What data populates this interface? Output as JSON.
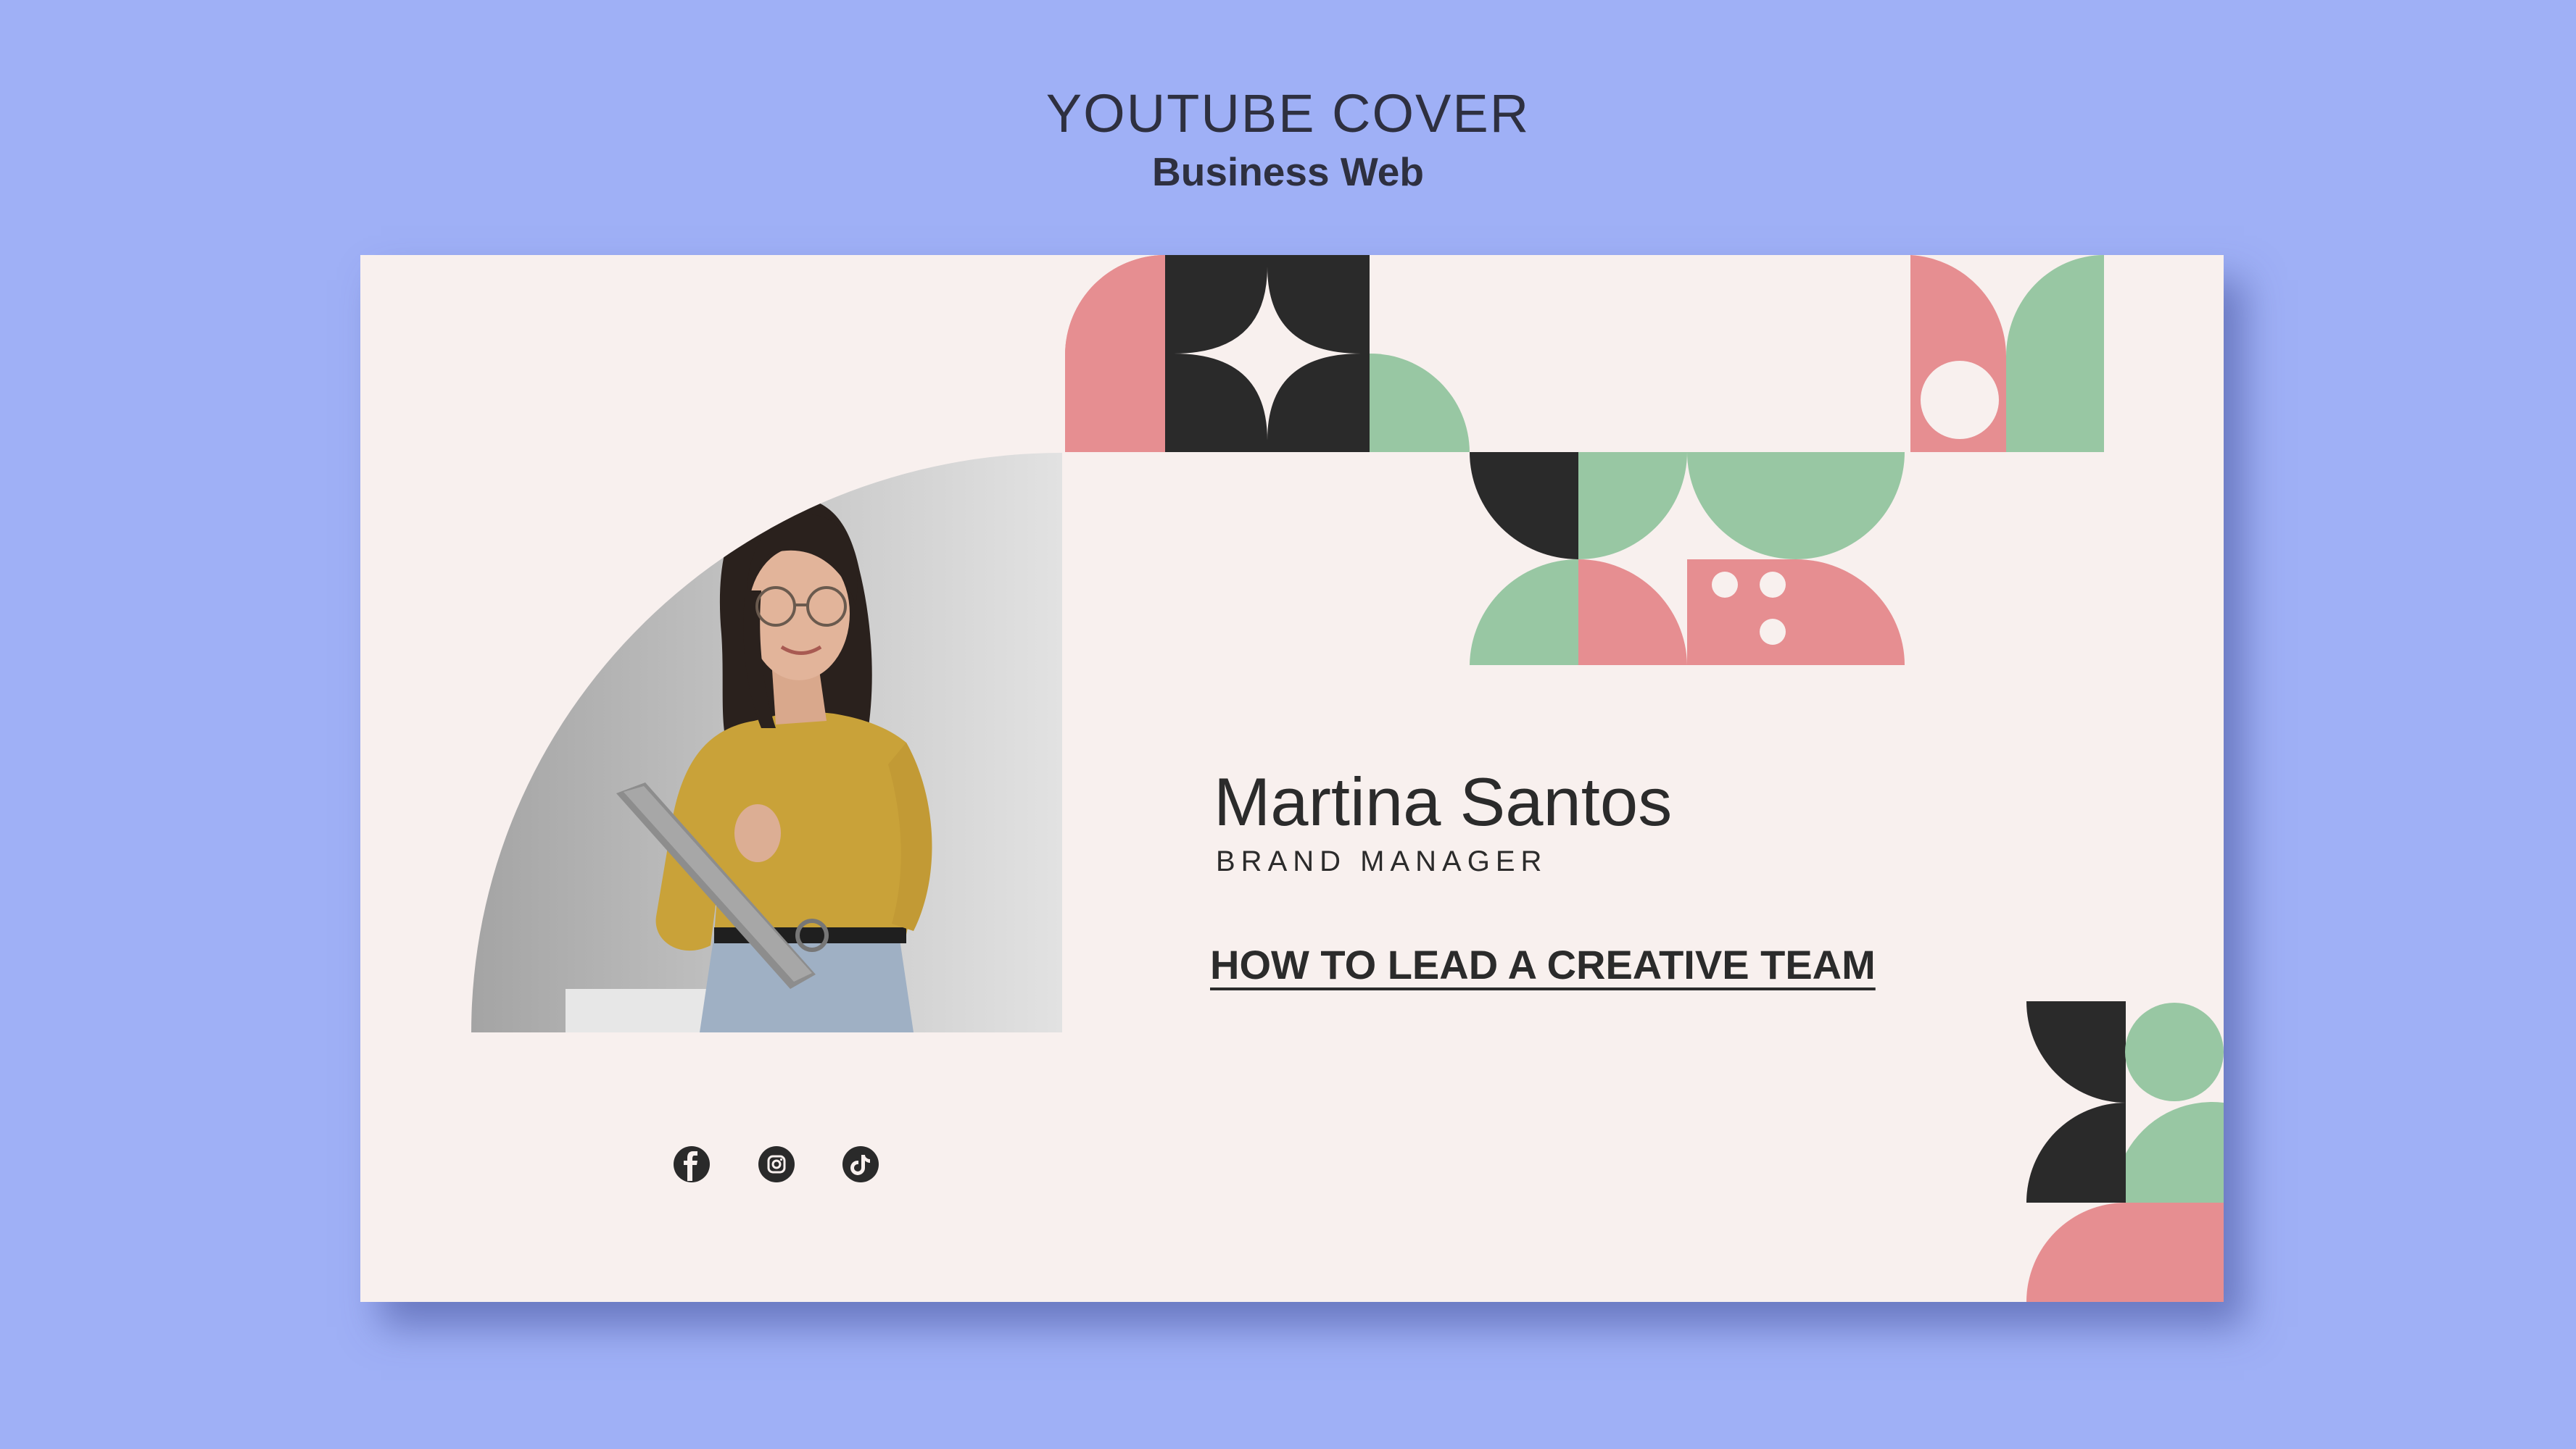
{
  "header": {
    "title": "YOUTUBE COVER",
    "subtitle": "Business Web"
  },
  "profile": {
    "name": "Martina Santos",
    "role": "BRAND MANAGER",
    "photo": "woman-with-glasses-holding-laptop"
  },
  "video": {
    "title": "HOW TO LEAD A CREATIVE TEAM"
  },
  "social": {
    "icons": [
      "facebook-icon",
      "instagram-icon",
      "tiktok-icon"
    ]
  },
  "colors": {
    "background": "#9fb0f6",
    "card": "#f8f0ee",
    "pink": "#e68e91",
    "green": "#98c7a3",
    "dark": "#2a2a2a",
    "text": "#2b2b2b"
  }
}
